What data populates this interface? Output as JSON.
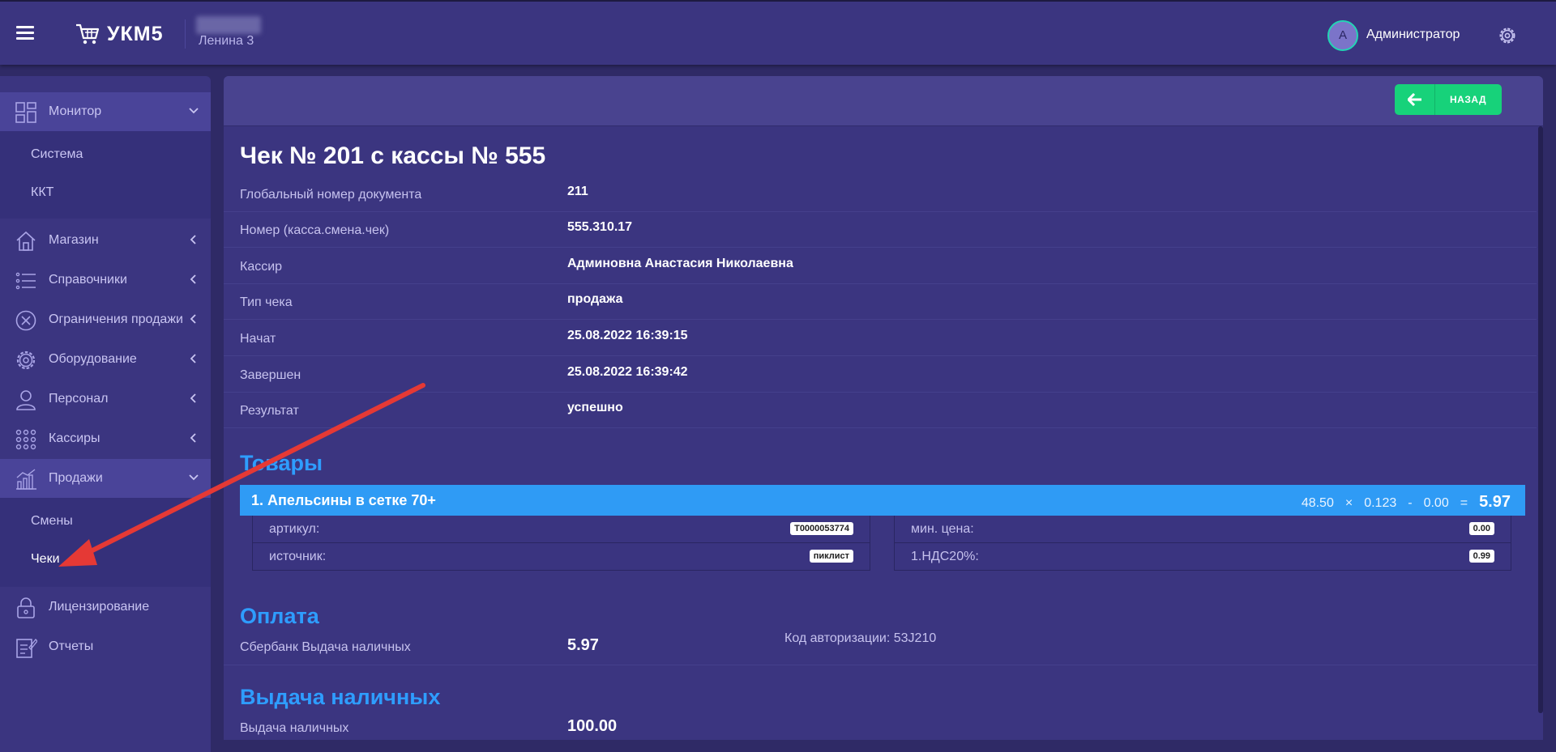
{
  "header": {
    "logo_text": "УКМ5",
    "store_name": "Ленина 3",
    "user_initial": "А",
    "user_name": "Администратор"
  },
  "sidebar": {
    "items": [
      {
        "label": "Монитор",
        "icon": "dashboard-icon"
      },
      {
        "label": "Магазин",
        "icon": "store-icon"
      },
      {
        "label": "Справочники",
        "icon": "list-icon"
      },
      {
        "label": "Ограничения продажи",
        "icon": "restriction-icon"
      },
      {
        "label": "Оборудование",
        "icon": "gear-icon"
      },
      {
        "label": "Персонал",
        "icon": "person-icon"
      },
      {
        "label": "Кассиры",
        "icon": "cashiers-icon"
      },
      {
        "label": "Продажи",
        "icon": "sales-chart-icon"
      },
      {
        "label": "Лицензирование",
        "icon": "lock-icon"
      },
      {
        "label": "Отчеты",
        "icon": "report-icon"
      }
    ],
    "monitor_sub": [
      "Система",
      "ККТ"
    ],
    "sales_sub": [
      "Смены",
      "Чеки"
    ]
  },
  "toolbar": {
    "back_label": "НАЗАД"
  },
  "receipt": {
    "title": "Чек № 201 с кассы № 555",
    "fields": [
      {
        "key": "Глобальный номер документа",
        "value": "211"
      },
      {
        "key": "Номер (касса.смена.чек)",
        "value": "555.310.17"
      },
      {
        "key": "Кассир",
        "value": "Админовна Анастасия Николаевна"
      },
      {
        "key": "Тип чека",
        "value": "продажа"
      },
      {
        "key": "Начат",
        "value": "25.08.2022 16:39:15"
      },
      {
        "key": "Завершен",
        "value": "25.08.2022 16:39:42"
      },
      {
        "key": "Результат",
        "value": "успешно"
      }
    ]
  },
  "goods": {
    "section_title": "Товары",
    "item": {
      "name": "1. Апельсины в сетке 70+",
      "price": "48.50",
      "times": "×",
      "qty": "0.123",
      "minus": "-",
      "discount": "0.00",
      "equals": "=",
      "total": "5.97"
    },
    "left_attrs": [
      {
        "key": "артикул:",
        "value": "Т0000053774"
      },
      {
        "key": "источник:",
        "value": "пиклист"
      }
    ],
    "right_attrs": [
      {
        "key": "мин. цена:",
        "value": "0.00"
      },
      {
        "key": "1.НДС20%:",
        "value": "0.99"
      }
    ]
  },
  "payment": {
    "section_title": "Оплата",
    "label": "Сбербанк Выдача наличных",
    "amount": "5.97",
    "auth_code": "Код авторизации: 53J210"
  },
  "cashout": {
    "section_title": "Выдача наличных",
    "label": "Выдача наличных",
    "amount": "100.00"
  },
  "colors": {
    "accent_blue": "#2f9bf5",
    "back_green": "#17d27a",
    "annotation_red": "#e53935"
  }
}
